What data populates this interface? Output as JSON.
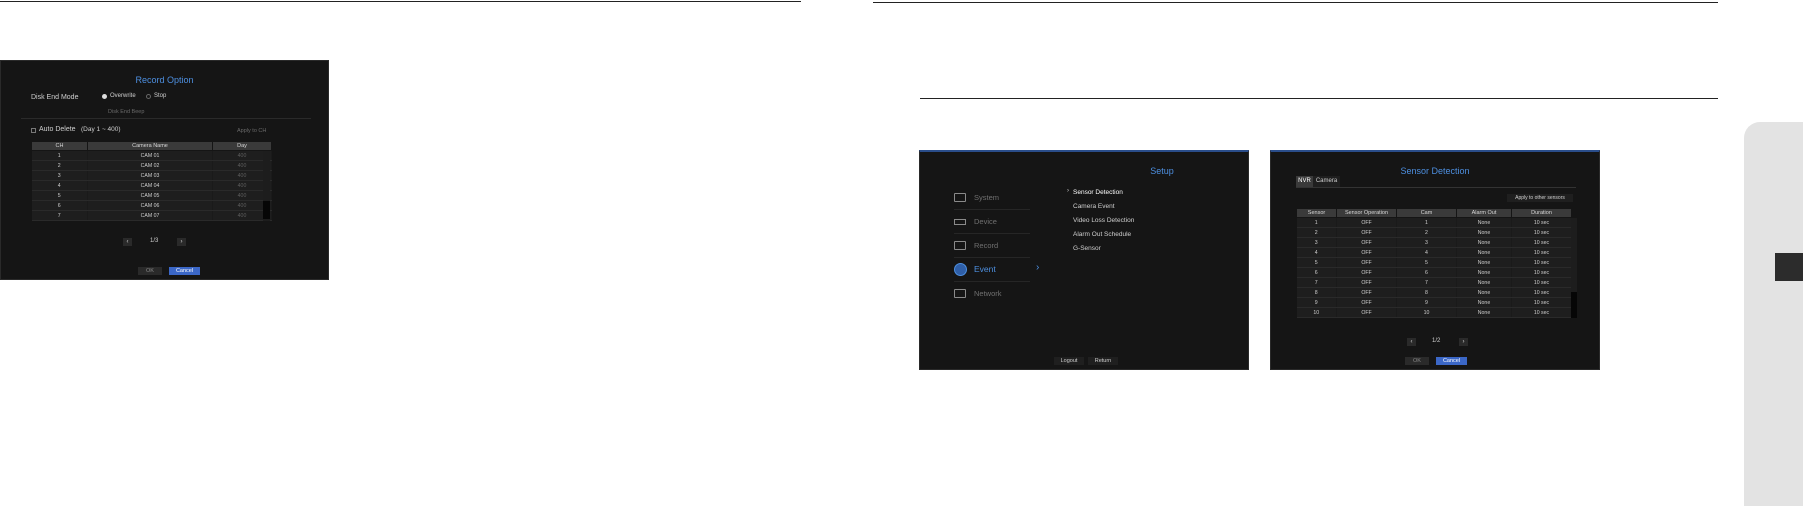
{
  "left_panel": {
    "title": "Record Option",
    "disk_end_mode_label": "Disk End Mode",
    "overwrite_label": "Overwrite",
    "stop_label": "Stop",
    "disk_end_beep_label": "Disk End Beep",
    "auto_delete_label": "Auto Delete",
    "day_range": "(Day 1 ~ 400)",
    "apply_to_ch": "Apply to CH",
    "columns": [
      "CH",
      "Camera Name",
      "Day"
    ],
    "rows": [
      {
        "ch": "1",
        "name": "CAM 01",
        "day": "400"
      },
      {
        "ch": "2",
        "name": "CAM 02",
        "day": "400"
      },
      {
        "ch": "3",
        "name": "CAM 03",
        "day": "400"
      },
      {
        "ch": "4",
        "name": "CAM 04",
        "day": "400"
      },
      {
        "ch": "5",
        "name": "CAM 05",
        "day": "400"
      },
      {
        "ch": "6",
        "name": "CAM 06",
        "day": "400"
      },
      {
        "ch": "7",
        "name": "CAM 07",
        "day": "400"
      }
    ],
    "page": "1/3",
    "ok": "OK",
    "cancel": "Cancel"
  },
  "setup_panel": {
    "title": "Setup",
    "menu": [
      "System",
      "Device",
      "Record",
      "Event",
      "Network"
    ],
    "active_menu": "Event",
    "submenu": [
      "Sensor Detection",
      "Camera Event",
      "Video Loss Detection",
      "Alarm Out Schedule",
      "G-Sensor"
    ],
    "logout": "Logout",
    "return": "Return"
  },
  "sensor_panel": {
    "title": "Sensor Detection",
    "tabs": [
      "NVR",
      "Camera"
    ],
    "apply_button": "Apply to other sensors",
    "columns": [
      "Sensor",
      "Sensor Operation",
      "Cam",
      "Alarm Out",
      "Duration"
    ],
    "rows": [
      {
        "sensor": "1",
        "op": "OFF",
        "cam": "1",
        "alarm": "None",
        "duration": "10 sec"
      },
      {
        "sensor": "2",
        "op": "OFF",
        "cam": "2",
        "alarm": "None",
        "duration": "10 sec"
      },
      {
        "sensor": "3",
        "op": "OFF",
        "cam": "3",
        "alarm": "None",
        "duration": "10 sec"
      },
      {
        "sensor": "4",
        "op": "OFF",
        "cam": "4",
        "alarm": "None",
        "duration": "10 sec"
      },
      {
        "sensor": "5",
        "op": "OFF",
        "cam": "5",
        "alarm": "None",
        "duration": "10 sec"
      },
      {
        "sensor": "6",
        "op": "OFF",
        "cam": "6",
        "alarm": "None",
        "duration": "10 sec"
      },
      {
        "sensor": "7",
        "op": "OFF",
        "cam": "7",
        "alarm": "None",
        "duration": "10 sec"
      },
      {
        "sensor": "8",
        "op": "OFF",
        "cam": "8",
        "alarm": "None",
        "duration": "10 sec"
      },
      {
        "sensor": "9",
        "op": "OFF",
        "cam": "9",
        "alarm": "None",
        "duration": "10 sec"
      },
      {
        "sensor": "10",
        "op": "OFF",
        "cam": "10",
        "alarm": "None",
        "duration": "10 sec"
      }
    ],
    "page": "1/2",
    "ok": "OK",
    "cancel": "Cancel"
  },
  "colors": {
    "accent": "#3b67c7",
    "title_blue": "#4d8fe0",
    "panel_bg": "#151515"
  }
}
